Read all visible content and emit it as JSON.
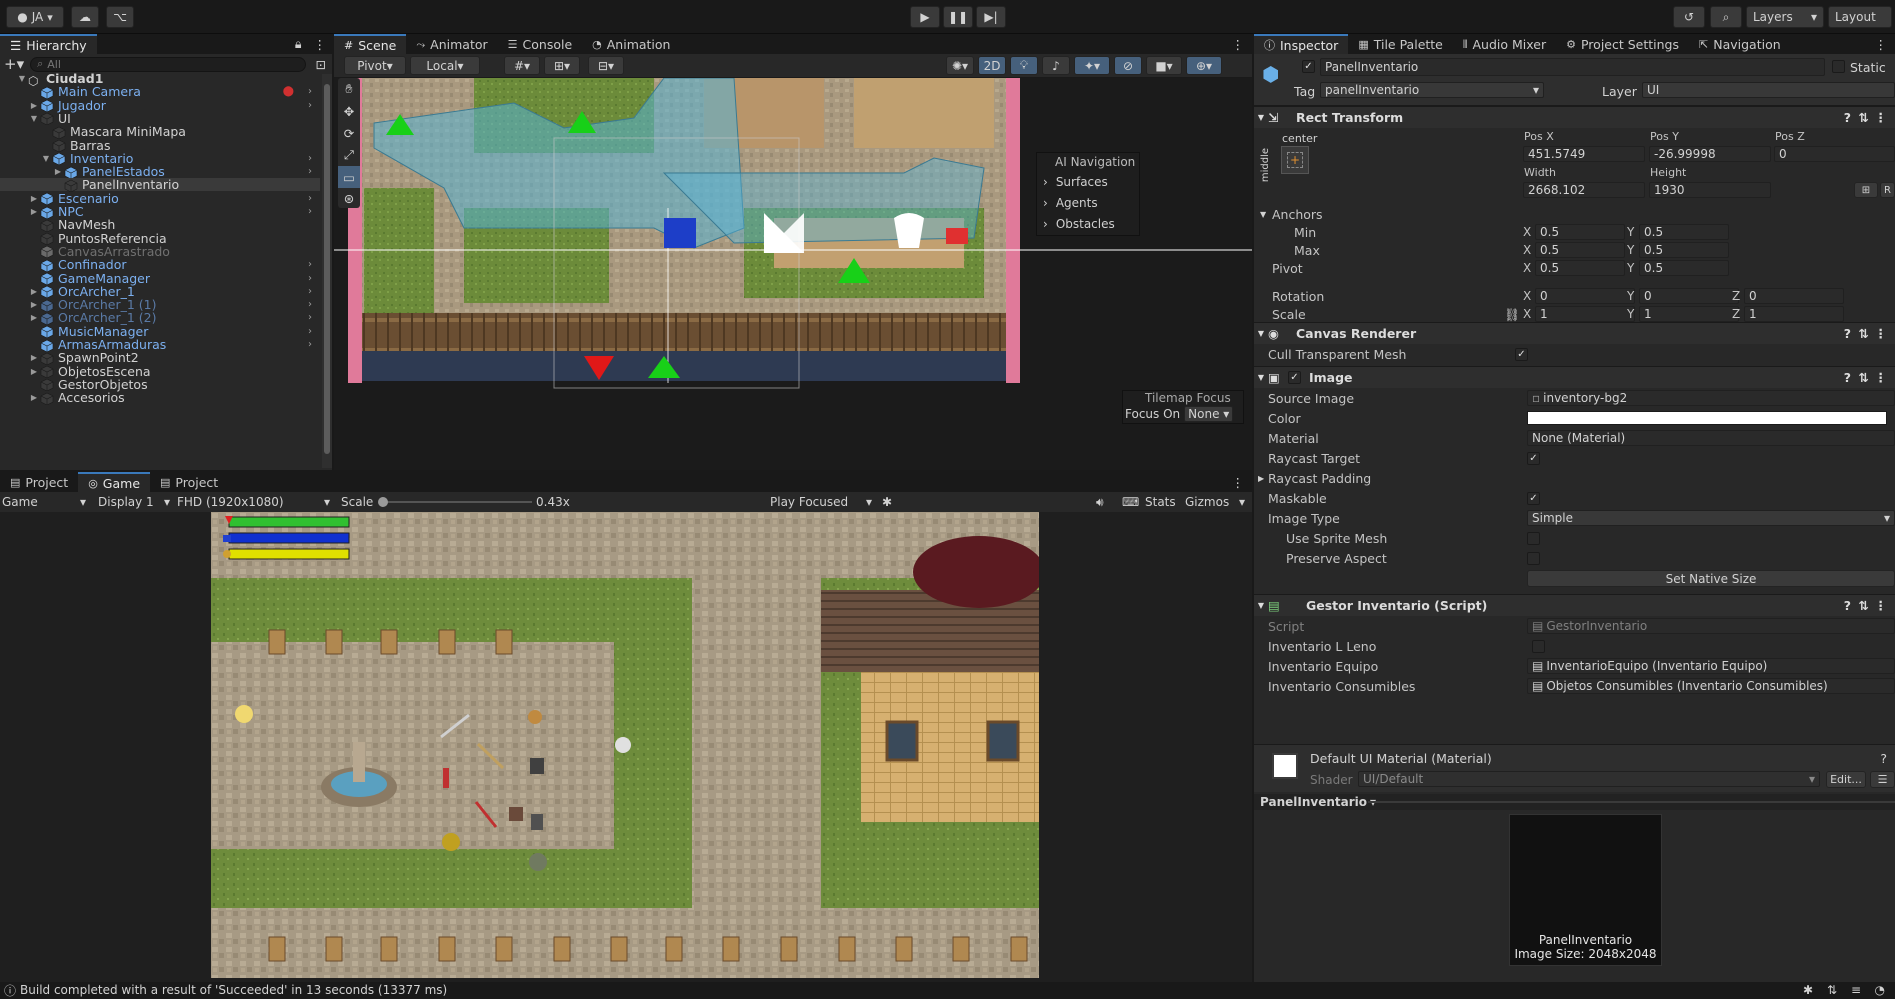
{
  "toolbar": {
    "account": "JA",
    "layers": "Layers",
    "layout": "Layout"
  },
  "hierarchy": {
    "tab": "Hierarchy",
    "search_placeholder": "All",
    "items": [
      {
        "label": "Ciudad1",
        "indent": 0,
        "type": "scene",
        "bold": true
      },
      {
        "label": "Main Camera",
        "indent": 1,
        "type": "prefab"
      },
      {
        "label": "Jugador",
        "indent": 1,
        "type": "prefab"
      },
      {
        "label": "UI",
        "indent": 1,
        "type": "go"
      },
      {
        "label": "Mascara MiniMapa",
        "indent": 2,
        "type": "go"
      },
      {
        "label": "Barras",
        "indent": 2,
        "type": "go"
      },
      {
        "label": "Inventario",
        "indent": 2,
        "type": "prefab"
      },
      {
        "label": "PanelEstados",
        "indent": 3,
        "type": "prefab"
      },
      {
        "label": "PanelInventario",
        "indent": 3,
        "type": "go"
      },
      {
        "label": "Escenario",
        "indent": 1,
        "type": "prefab"
      },
      {
        "label": "NPC",
        "indent": 1,
        "type": "prefab"
      },
      {
        "label": "NavMesh",
        "indent": 1,
        "type": "go"
      },
      {
        "label": "PuntosReferencia",
        "indent": 1,
        "type": "go"
      },
      {
        "label": "CanvasArrastrado",
        "indent": 1,
        "type": "disabled"
      },
      {
        "label": "Confinador",
        "indent": 1,
        "type": "prefab"
      },
      {
        "label": "GameManager",
        "indent": 1,
        "type": "prefab"
      },
      {
        "label": "OrcArcher_1",
        "indent": 1,
        "type": "prefab"
      },
      {
        "label": "OrcArcher_1 (1)",
        "indent": 1,
        "type": "missing"
      },
      {
        "label": "OrcArcher_1 (2)",
        "indent": 1,
        "type": "missing"
      },
      {
        "label": "MusicManager",
        "indent": 1,
        "type": "prefab"
      },
      {
        "label": "ArmasArmaduras",
        "indent": 1,
        "type": "prefab"
      },
      {
        "label": "SpawnPoint2",
        "indent": 1,
        "type": "go"
      },
      {
        "label": "ObjetosEscena",
        "indent": 1,
        "type": "go"
      },
      {
        "label": "GestorObjetos",
        "indent": 1,
        "type": "go"
      },
      {
        "label": "Accesorios",
        "indent": 1,
        "type": "go"
      }
    ]
  },
  "scene": {
    "tabs": [
      "Scene",
      "Animator",
      "Console",
      "Animation"
    ],
    "pivot": "Pivot",
    "local": "Local",
    "mode2d": "2D",
    "overlay_title": "AI Navigation",
    "overlay_items": [
      "Surfaces",
      "Agents",
      "Obstacles"
    ],
    "tilemap_title": "Tilemap Focus",
    "focus_on": "Focus On",
    "focus_value": "None"
  },
  "game": {
    "tabs": [
      "Project",
      "Game",
      "Project"
    ],
    "game_dropdown": "Game",
    "display": "Display 1",
    "resolution": "FHD (1920x1080)",
    "scale_label": "Scale",
    "scale_value": "0.43x",
    "play_focused": "Play Focused",
    "stats": "Stats",
    "gizmos": "Gizmos"
  },
  "inspector": {
    "tabs": [
      "Inspector",
      "Tile Palette",
      "Audio Mixer",
      "Project Settings",
      "Navigation"
    ],
    "object_name": "PanelInventario",
    "static": "Static",
    "tag_label": "Tag",
    "tag_value": "panelInventario",
    "layer_label": "Layer",
    "layer_value": "UI",
    "rect": {
      "title": "Rect Transform",
      "anchor_text": "center",
      "side_text": "middle",
      "posx_label": "Pos X",
      "posy_label": "Pos Y",
      "posz_label": "Pos Z",
      "posx": "451.5749",
      "posy": "-26.99998",
      "posz": "0",
      "width_label": "Width",
      "height_label": "Height",
      "width": "2668.102",
      "height": "1930",
      "anchors": "Anchors",
      "min": "Min",
      "max": "Max",
      "pivot": "Pivot",
      "rotation": "Rotation",
      "scale": "Scale",
      "min_x": "0.5",
      "min_y": "0.5",
      "max_x": "0.5",
      "max_y": "0.5",
      "pivot_x": "0.5",
      "pivot_y": "0.5",
      "rot_x": "0",
      "rot_y": "0",
      "rot_z": "0",
      "scale_x": "1",
      "scale_y": "1",
      "scale_z": "1"
    },
    "canvas_renderer": {
      "title": "Canvas Renderer",
      "cull": "Cull Transparent Mesh"
    },
    "image": {
      "title": "Image",
      "source_label": "Source Image",
      "source": "inventory-bg2",
      "color_label": "Color",
      "material_label": "Material",
      "material": "None (Material)",
      "raycast_target": "Raycast Target",
      "raycast_padding": "Raycast Padding",
      "maskable": "Maskable",
      "image_type_label": "Image Type",
      "image_type": "Simple",
      "use_sprite_mesh": "Use Sprite Mesh",
      "preserve_aspect": "Preserve Aspect",
      "native_size": "Set Native Size"
    },
    "gestor": {
      "title": "Gestor Inventario (Script)",
      "script_label": "Script",
      "script": "GestorInventario",
      "lleno_label": "Inventario L Leno",
      "equipo_label": "Inventario Equipo",
      "equipo": "InventarioEquipo (Inventario Equipo)",
      "consumibles_label": "Inventario Consumibles",
      "consumibles": "Objetos Consumibles (Inventario Consumibles)"
    },
    "material": {
      "title": "Default UI Material (Material)",
      "shader_label": "Shader",
      "shader": "UI/Default",
      "edit": "Edit..."
    },
    "preview": {
      "dropdown": "PanelInventario",
      "name": "PanelInventario",
      "size": "Image Size: 2048x2048"
    }
  },
  "status": {
    "message": "Build completed with a result of 'Succeeded' in 13 seconds (13377 ms)"
  },
  "colors": {
    "accent": "#3a79bb",
    "prefab": "#7cb0f0",
    "health": "#30c030",
    "mana": "#1030d0",
    "stamina": "#e0e000"
  }
}
